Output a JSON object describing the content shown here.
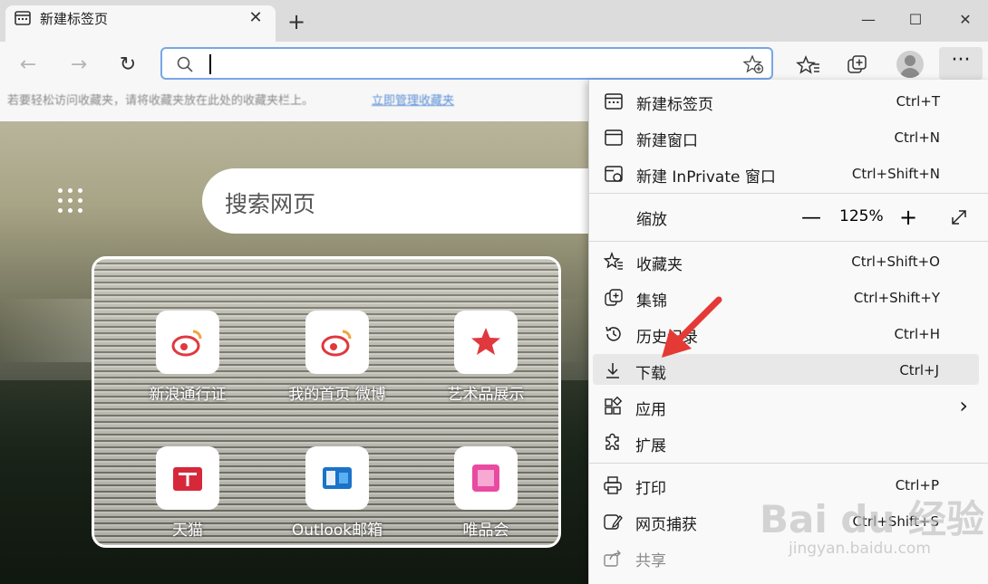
{
  "tab": {
    "title": "新建标签页",
    "close": "✕",
    "new_tab": "+"
  },
  "window": {
    "minimize": "—",
    "maximize": "☐",
    "close": "✕"
  },
  "toolbar": {
    "back": "←",
    "forward": "→",
    "refresh": "↻",
    "menu": "···"
  },
  "address": {
    "value": ""
  },
  "infobar": {
    "text": "若要轻松访问收藏夹，请将收藏夹放在此处的收藏夹栏上。",
    "link": "立即管理收藏夹"
  },
  "page": {
    "search_placeholder": "搜索网页"
  },
  "tiles": [
    {
      "label": "新浪通行证"
    },
    {
      "label": "我的首页 微博"
    },
    {
      "label": "艺术品展示"
    },
    {
      "label": "天猫"
    },
    {
      "label": "Outlook邮箱"
    },
    {
      "label": "唯品会"
    }
  ],
  "menu": {
    "new_tab": {
      "label": "新建标签页",
      "shortcut": "Ctrl+T"
    },
    "new_window": {
      "label": "新建窗口",
      "shortcut": "Ctrl+N"
    },
    "new_inprivate": {
      "label": "新建 InPrivate 窗口",
      "shortcut": "Ctrl+Shift+N"
    },
    "zoom": {
      "label": "缩放",
      "minus": "—",
      "value": "125%",
      "plus": "+"
    },
    "favorites": {
      "label": "收藏夹",
      "shortcut": "Ctrl+Shift+O"
    },
    "collections": {
      "label": "集锦",
      "shortcut": "Ctrl+Shift+Y"
    },
    "history": {
      "label": "历史记录",
      "shortcut": "Ctrl+H"
    },
    "downloads": {
      "label": "下载",
      "shortcut": "Ctrl+J"
    },
    "apps": {
      "label": "应用",
      "chevron": "›"
    },
    "extensions": {
      "label": "扩展"
    },
    "print": {
      "label": "打印",
      "shortcut": "Ctrl+P"
    },
    "web_capture": {
      "label": "网页捕获",
      "shortcut": "Ctrl+Shift+S"
    },
    "share": {
      "label": "共享"
    }
  },
  "watermark": {
    "text": "Bai du 经验",
    "sub": "jingyan.baidu.com"
  },
  "colors": {
    "accent_border": "#77a7e8",
    "arrow": "#e53935"
  }
}
